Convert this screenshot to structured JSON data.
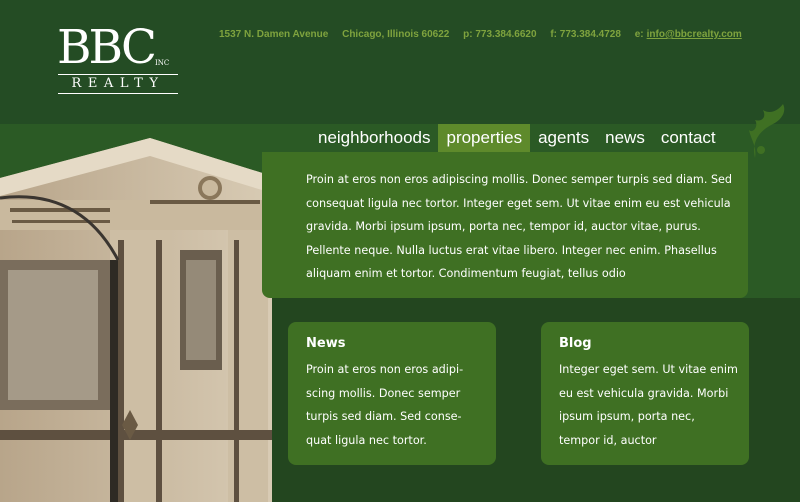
{
  "brand": {
    "logo_main": "BBC",
    "logo_inc": "INC",
    "logo_sub": "REALTY"
  },
  "contact": {
    "address": "1537 N. Damen Avenue",
    "city": "Chicago, Illinois 60622",
    "phone": "p: 773.384.6620",
    "fax": "f: 773.384.4728",
    "email_prefix": "e:",
    "email": "info@bbcrealty.com"
  },
  "nav": {
    "items": [
      {
        "label": "neighborhoods"
      },
      {
        "label": "properties"
      },
      {
        "label": "agents"
      },
      {
        "label": "news"
      },
      {
        "label": "contact"
      }
    ],
    "active": "properties"
  },
  "intro": {
    "text": "Proin at eros non eros adipiscing mollis. Donec semper turpis sed diam. Sed consequat ligula nec tortor. Integer eget sem. Ut vitae enim eu est vehicula gravida. Morbi ipsum ipsum, porta nec, tempor id, auctor vitae, purus. Pellente neque. Nulla luctus erat vitae libero. Integer nec enim. Phasellus aliquam enim et tortor. Condimentum feugiat, tellus odio"
  },
  "news": {
    "title": "News",
    "text": "Proin at eros non eros adipi-scing mollis. Donec semper turpis sed diam. Sed conse-quat ligula nec tortor."
  },
  "blog": {
    "title": "Blog",
    "text": "Integer eget sem. Ut vitae enim eu est vehicula gravida. Morbi ipsum ipsum, porta nec, tempor id, auctor"
  },
  "colors": {
    "header_bg": "#244c24",
    "box_bg": "#3f7023",
    "nav_active": "#5e8a2b",
    "contact_text": "#7fa33e"
  }
}
